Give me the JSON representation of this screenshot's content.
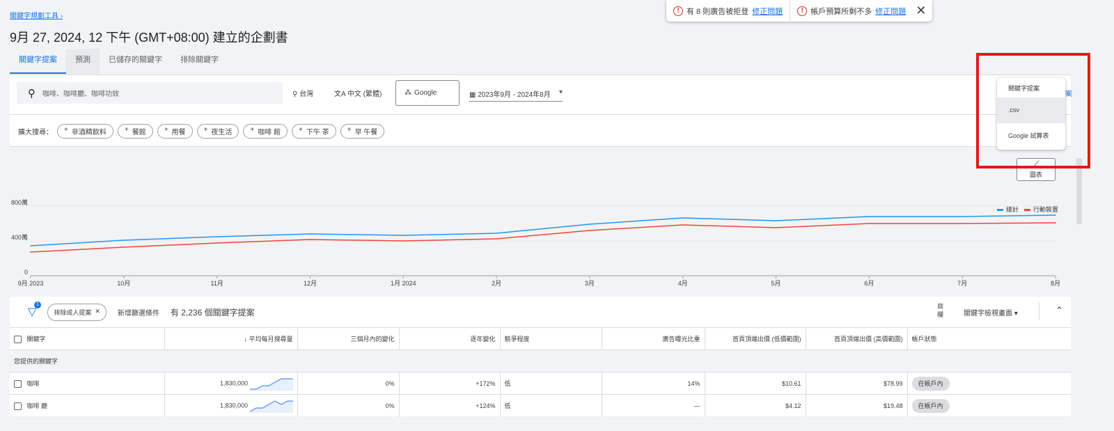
{
  "breadcrumb": "關鍵字規劃工具",
  "title": "9月 27, 2024, 12 下午 (GMT+08:00) 建立的企劃書",
  "tabs": [
    {
      "label": "關鍵字提案"
    },
    {
      "label": "預測"
    },
    {
      "label": "已儲存的關鍵字"
    },
    {
      "label": "排除關鍵字"
    }
  ],
  "search": {
    "value": "咖啡、咖啡廳、咖啡功效",
    "icon": "search-icon"
  },
  "location": "台灣",
  "language": "中文 (繁體)",
  "network": "Google",
  "date_range": "2023年9月 - 2024年8月",
  "expand": {
    "label": "擴大搜尋：",
    "chips": [
      "非酒精飲料",
      "餐館",
      "用餐",
      "夜生活",
      "咖啡 館",
      "下午 茶",
      "早 午餐"
    ]
  },
  "notifications": [
    {
      "text": "有 8 則廣告被拒登",
      "link": "修正問題"
    },
    {
      "text": "帳戶預算所剩不多",
      "link": "修正問題"
    }
  ],
  "download_menu": {
    "header": "關鍵字提案",
    "items": [
      ".csv",
      "Google 試算表"
    ],
    "partial_link": "案"
  },
  "chart_button": "圖表",
  "chart_data": {
    "type": "line",
    "categories": [
      "9月 2023",
      "10月",
      "11月",
      "12月",
      "1月 2024",
      "2月",
      "3月",
      "4月",
      "5月",
      "6月",
      "7月",
      "8月"
    ],
    "yticks": [
      "0",
      "400萬",
      "800萬"
    ],
    "ylim": [
      0,
      9000000
    ],
    "series": [
      {
        "name": "總計",
        "color": "#2196f3",
        "values": [
          3440000,
          4080000,
          4480000,
          4800000,
          4640000,
          4880000,
          5920000,
          6640000,
          6320000,
          6800000,
          6800000,
          6960000
        ]
      },
      {
        "name": "行動裝置",
        "color": "#f44336",
        "values": [
          2720000,
          3280000,
          3760000,
          4160000,
          4000000,
          4240000,
          5200000,
          5840000,
          5520000,
          6000000,
          6000000,
          6080000
        ]
      }
    ],
    "grid": true,
    "legend": "top-right"
  },
  "table": {
    "filter_count": "1",
    "filter_chip": "排除成人提案",
    "add_filter": "新增篩選條件",
    "summary": "有 2,236 個關鍵字提案",
    "columns_label": "欄",
    "view_label": "關鍵字檢視畫面",
    "headers": [
      "關鍵字",
      "平均每月搜尋量",
      "三個月內的變化",
      "逐年變化",
      "競爭程度",
      "廣告曝光比重",
      "首頁頂端出價 (低價範圍)",
      "首頁頂端出價 (高價範圍)",
      "帳戶狀態"
    ],
    "group": "您提供的關鍵字",
    "rows": [
      {
        "keyword": "咖啡",
        "volume": "1,830,000",
        "three_month": "0%",
        "yoy": "+172%",
        "competition": "低",
        "impression_share": "14%",
        "bid_low": "$10.61",
        "bid_high": "$78.99",
        "status": "在帳戶內"
      },
      {
        "keyword": "咖啡 廳",
        "volume": "1,830,000",
        "three_month": "0%",
        "yoy": "+124%",
        "competition": "低",
        "impression_share": "—",
        "bid_low": "$4.12",
        "bid_high": "$19.48",
        "status": "在帳戶內"
      }
    ]
  }
}
